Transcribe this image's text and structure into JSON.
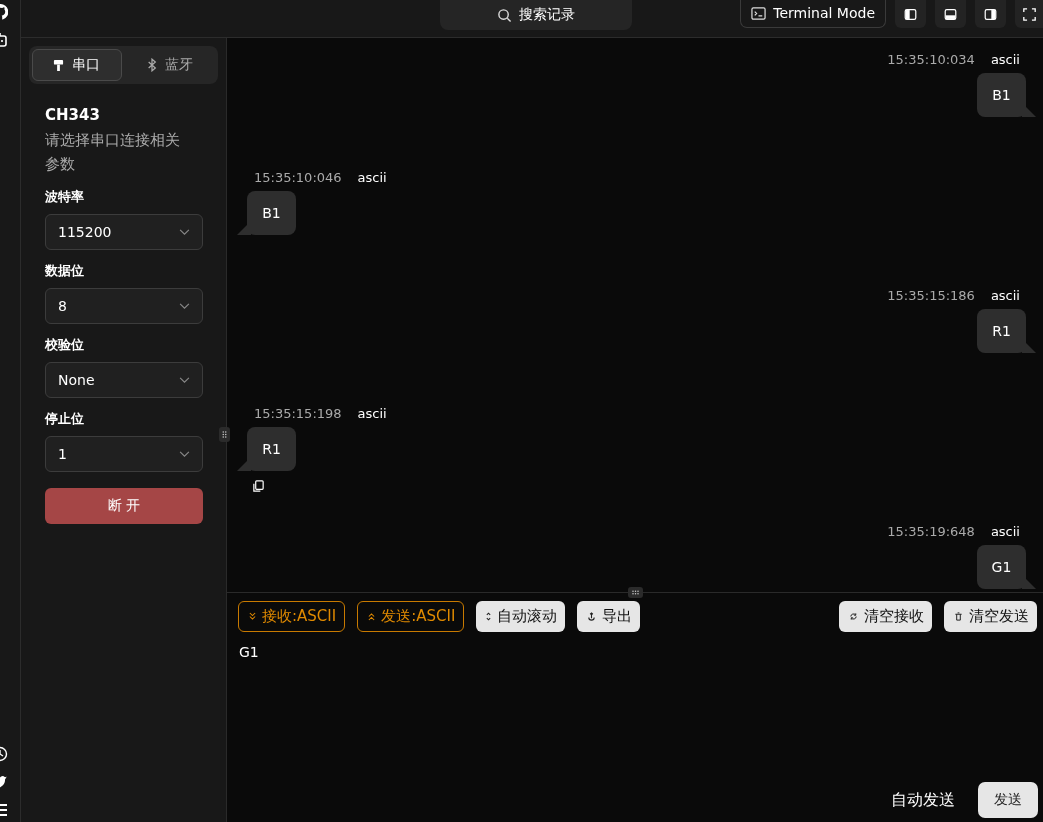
{
  "top_bar": {
    "search": "搜索记录",
    "mode_button": "Terminal Mode"
  },
  "connection_tabs": [
    {
      "label": "串口",
      "selected": true,
      "kind": "serial"
    },
    {
      "label": "蓝牙",
      "selected": false,
      "kind": "bluetooth"
    }
  ],
  "device": {
    "name": "CH343",
    "description": "请选择串口连接相关参数"
  },
  "settings": [
    {
      "label": "波特率",
      "value": "115200"
    },
    {
      "label": "数据位",
      "value": "8"
    },
    {
      "label": "校验位",
      "value": "None"
    },
    {
      "label": "停止位",
      "value": "1"
    }
  ],
  "disconnect_button": "断 开",
  "messages": [
    {
      "kind": "sent",
      "time": "15:35:10:034",
      "encoding": "ascii",
      "text": "B1",
      "show_copy": false
    },
    {
      "kind": "received",
      "time": "15:35:10:046",
      "encoding": "ascii",
      "text": "B1",
      "show_copy": false
    },
    {
      "kind": "sent",
      "time": "15:35:15:186",
      "encoding": "ascii",
      "text": "R1",
      "show_copy": false
    },
    {
      "kind": "received",
      "time": "15:35:15:198",
      "encoding": "ascii",
      "text": "R1",
      "show_copy": true
    },
    {
      "kind": "sent",
      "time": "15:35:19:648",
      "encoding": "ascii",
      "text": "G1",
      "show_copy": false
    }
  ],
  "toolbar_left": [
    {
      "kind": "receive",
      "label": "接收:ASCII"
    },
    {
      "kind": "send",
      "label": "发送:ASCII"
    },
    {
      "kind": "scroll",
      "label": "自动滚动"
    },
    {
      "kind": "export",
      "label": "导出"
    }
  ],
  "toolbar_right": [
    {
      "kind": "clear_receive",
      "label": "清空接收"
    },
    {
      "kind": "clear_send",
      "label": "清空发送"
    }
  ],
  "input": {
    "value": "G1"
  },
  "auto_send_label": "自动发送",
  "send_button": "发送"
}
